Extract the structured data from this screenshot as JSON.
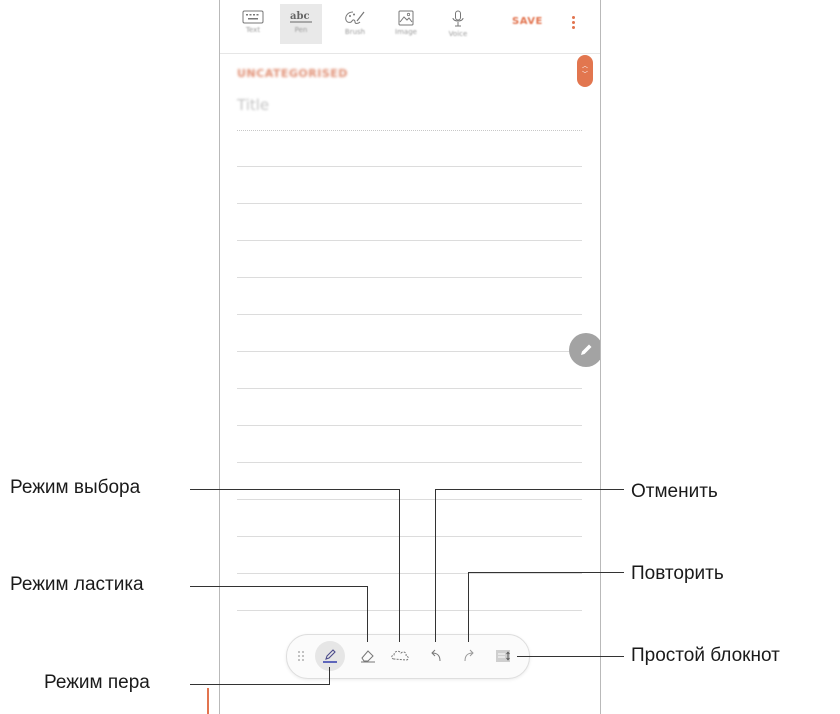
{
  "toolbar": {
    "tools": [
      {
        "name": "keyboard-icon",
        "label": "Text"
      },
      {
        "name": "handwriting-icon",
        "label": "Pen"
      },
      {
        "name": "palette-icon",
        "label": "Brush"
      },
      {
        "name": "image-icon",
        "label": "Image"
      },
      {
        "name": "microphone-icon",
        "label": "Voice"
      }
    ],
    "save_label": "SAVE"
  },
  "note": {
    "category_placeholder": "UNCATEGORISED",
    "title_placeholder": "Title"
  },
  "pen_toolbar": {
    "buttons": [
      "pen-mode",
      "eraser-mode",
      "selection-mode",
      "undo",
      "redo",
      "simple-notepad"
    ]
  },
  "callouts": {
    "selection_mode": "Режим выбора",
    "eraser_mode": "Режим ластика",
    "pen_mode": "Режим пера",
    "undo": "Отменить",
    "redo": "Повторить",
    "simple_notepad": "Простой блокнот"
  },
  "colors": {
    "accent": "#e2744f",
    "ruled_line": "#dcdcdc",
    "fab": "#a3a3a3"
  }
}
